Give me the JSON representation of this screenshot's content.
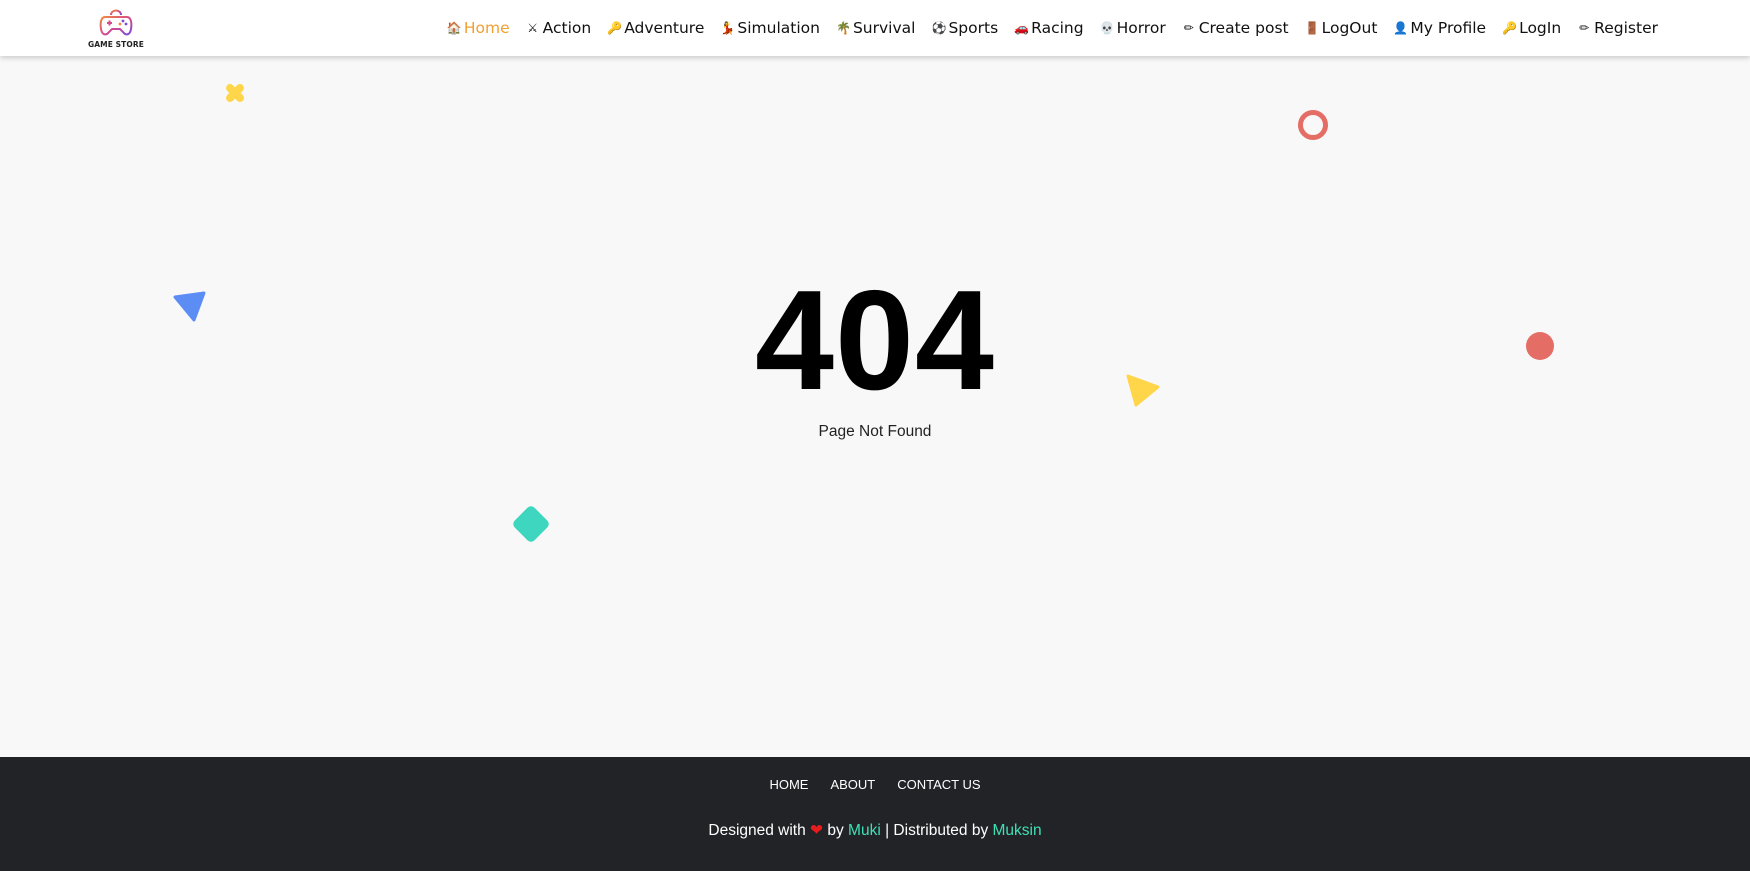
{
  "brand": {
    "logo_text": "GAME STORE"
  },
  "nav": {
    "items": [
      {
        "label": "Home",
        "icon": "house-icon",
        "glyph": "🏠",
        "active": true
      },
      {
        "label": "Action",
        "icon": "action-icon",
        "glyph": "⚔",
        "active": false
      },
      {
        "label": "Adventure",
        "icon": "key-icon",
        "glyph": "🔑",
        "active": false
      },
      {
        "label": "Simulation",
        "icon": "simulation-icon",
        "glyph": "💃",
        "active": false
      },
      {
        "label": "Survival",
        "icon": "palm-tree-icon",
        "glyph": "🌴",
        "active": false
      },
      {
        "label": "Sports",
        "icon": "soccer-ball-icon",
        "glyph": "⚽",
        "active": false
      },
      {
        "label": "Racing",
        "icon": "car-icon",
        "glyph": "🚗",
        "active": false
      },
      {
        "label": "Horror",
        "icon": "skull-icon",
        "glyph": "💀",
        "active": false
      },
      {
        "label": "Create post",
        "icon": "pencil-icon",
        "glyph": "✏",
        "active": false
      },
      {
        "label": "LogOut",
        "icon": "door-icon",
        "glyph": "🚪",
        "active": false
      },
      {
        "label": "My Profile",
        "icon": "person-icon",
        "glyph": "👤",
        "active": false
      },
      {
        "label": "LogIn",
        "icon": "key-icon",
        "glyph": "🔑",
        "active": false
      },
      {
        "label": "Register",
        "icon": "pencil-icon",
        "glyph": "✏",
        "active": false
      }
    ]
  },
  "error": {
    "code": "404",
    "message": "Page Not Found"
  },
  "footer": {
    "links": [
      "HOME",
      "ABOUT",
      "CONTACT US"
    ],
    "credit_prefix": "Designed with",
    "credit_by": "by",
    "credit_author": "Muki",
    "credit_separator": "| Distributed by",
    "credit_distributor": "Muksin"
  },
  "colors": {
    "accent": "#f0a030",
    "footer_bg": "#212327",
    "credit_link": "#3fe0b8",
    "shape_yellow": "#ffd54a",
    "shape_blue": "#5b8df5",
    "shape_teal": "#3ed6bf",
    "shape_red": "#e46e66",
    "heart": "#e81c1c"
  }
}
